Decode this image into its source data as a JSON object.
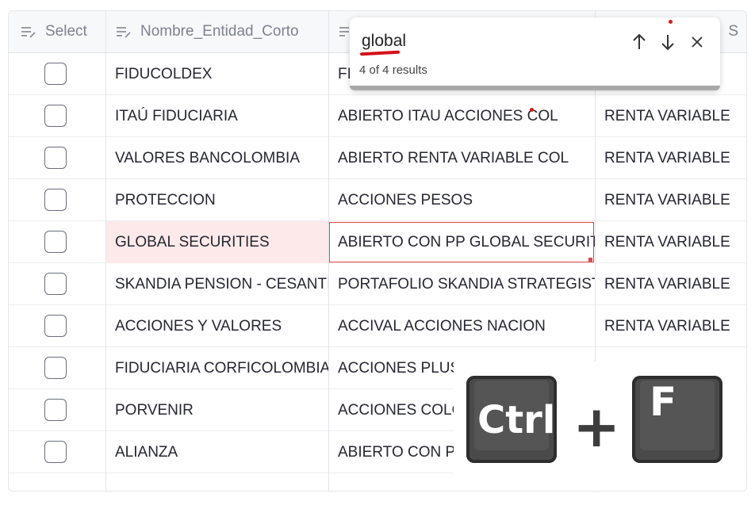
{
  "header": {
    "col1": "Select",
    "col2": "Nombre_Entidad_Corto",
    "col3_icon": "column-menu-icon",
    "col4_tail": "S"
  },
  "rows": [
    {
      "entidad": "FIDUCOLDEX",
      "fondo": "FI",
      "tipo": ""
    },
    {
      "entidad": "ITAÚ FIDUCIARIA",
      "fondo": "ABIERTO ITAU ACCIONES COL",
      "tipo": "RENTA VARIABLE"
    },
    {
      "entidad": "VALORES BANCOLOMBIA",
      "fondo": "ABIERTO RENTA VARIABLE COL",
      "tipo": "RENTA VARIABLE"
    },
    {
      "entidad": "PROTECCION",
      "fondo": "ACCIONES  PESOS",
      "tipo": "RENTA VARIABLE"
    },
    {
      "entidad": "GLOBAL SECURITIES",
      "fondo": "ABIERTO CON PP GLOBAL SECURITIE",
      "tipo": "RENTA VARIABLE"
    },
    {
      "entidad": "SKANDIA PENSION - CESANTÍA",
      "fondo": "PORTAFOLIO SKANDIA STRATEGIST A",
      "tipo": "RENTA VARIABLE"
    },
    {
      "entidad": "ACCIONES Y VALORES",
      "fondo": "ACCIVAL ACCIONES NACION",
      "tipo": "RENTA VARIABLE"
    },
    {
      "entidad": "FIDUCIARIA CORFICOLOMBIAN",
      "fondo": "ACCIONES PLUS",
      "tipo": ""
    },
    {
      "entidad": "PORVENIR",
      "fondo": "ACCIONES COLO",
      "tipo": ""
    },
    {
      "entidad": "ALIANZA",
      "fondo": "ABIERTO CON PF",
      "tipo": ""
    }
  ],
  "find": {
    "query": "global",
    "results": "4 of 4 results",
    "up_icon": "arrow-up-icon",
    "down_icon": "arrow-down-icon",
    "close_icon": "close-icon"
  },
  "shortcut": {
    "key1": "Ctrl",
    "plus": "+",
    "key2": "F"
  },
  "colors": {
    "highlight_row": "#fde9ea",
    "selection_outline": "#e0474c",
    "annotation_red": "#d60f18"
  }
}
